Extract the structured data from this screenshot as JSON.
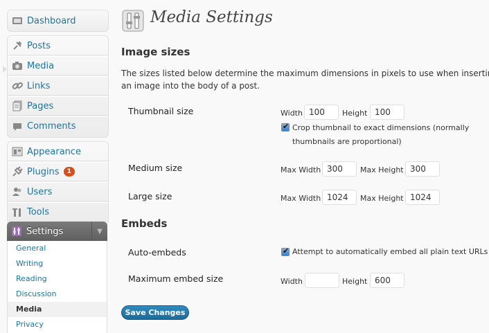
{
  "sidebar": {
    "dashboard": "Dashboard",
    "group1": [
      {
        "label": "Posts",
        "icon": "posts-pin-icon"
      },
      {
        "label": "Media",
        "icon": "media-camera-icon"
      },
      {
        "label": "Links",
        "icon": "links-chain-icon"
      },
      {
        "label": "Pages",
        "icon": "pages-icon"
      },
      {
        "label": "Comments",
        "icon": "comments-bubble-icon"
      }
    ],
    "group2": [
      {
        "label": "Appearance",
        "icon": "appearance-icon"
      },
      {
        "label": "Plugins",
        "icon": "plugins-plug-icon",
        "badge": "1"
      },
      {
        "label": "Users",
        "icon": "users-icon"
      },
      {
        "label": "Tools",
        "icon": "tools-icon"
      }
    ],
    "settings": "Settings",
    "submenu": [
      "General",
      "Writing",
      "Reading",
      "Discussion",
      "Media",
      "Privacy"
    ],
    "current_submenu": "Media"
  },
  "page": {
    "title": "Media Settings"
  },
  "image_sizes": {
    "heading": "Image sizes",
    "description": "The sizes listed below determine the maximum dimensions in pixels to use when inserting an image into the body of a post.",
    "thumbnail": {
      "label": "Thumbnail size",
      "width_label": "Width",
      "width": "100",
      "height_label": "Height",
      "height": "100",
      "crop_label": "Crop thumbnail to exact dimensions (normally thumbnails are proportional)",
      "crop_checked": true
    },
    "medium": {
      "label": "Medium size",
      "max_width_label": "Max Width",
      "max_width": "300",
      "max_height_label": "Max Height",
      "max_height": "300"
    },
    "large": {
      "label": "Large size",
      "max_width_label": "Max Width",
      "max_width": "1024",
      "max_height_label": "Max Height",
      "max_height": "1024"
    }
  },
  "embeds": {
    "heading": "Embeds",
    "auto_label": "Auto-embeds",
    "auto_checkbox_label": "Attempt to automatically embed all plain text URLs",
    "auto_checked": true,
    "max_label": "Maximum embed size",
    "width_label": "Width",
    "width": "",
    "height_label": "Height",
    "height": "600"
  },
  "actions": {
    "save": "Save Changes"
  },
  "colors": {
    "link": "#21759b",
    "badge": "#d54e21",
    "button": "#21759b"
  }
}
